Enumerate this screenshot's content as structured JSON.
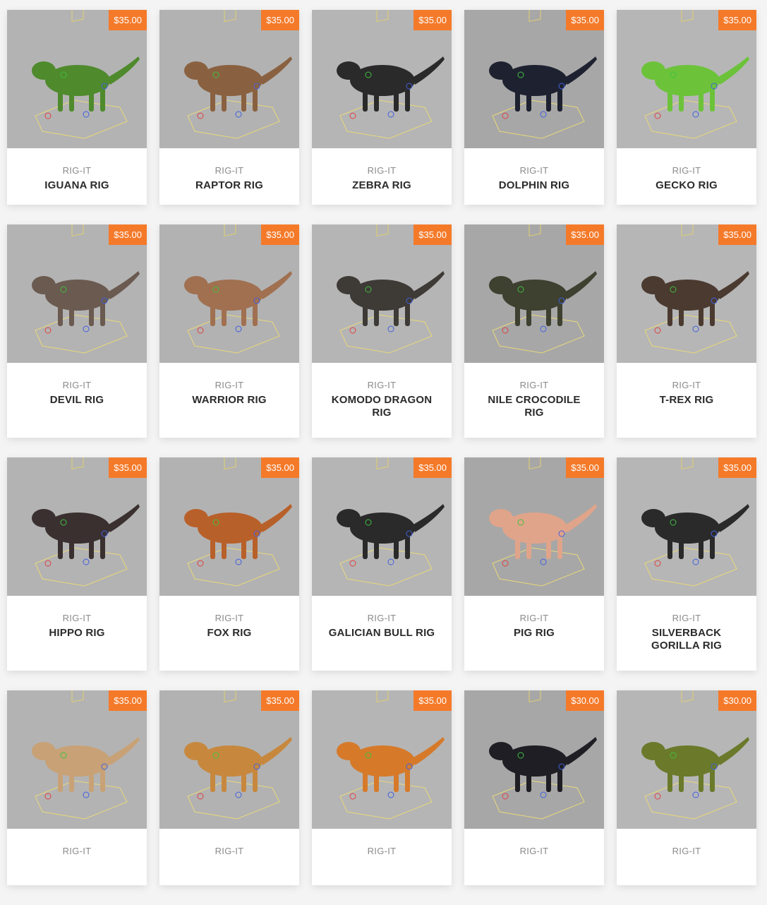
{
  "brand_label": "RIG-IT",
  "colors": {
    "price_badge": "#f47a2a",
    "thumb_bg": "#b4b4b4",
    "page_bg": "#f4f4f4"
  },
  "products": [
    {
      "name": "IGUANA RIG",
      "price": "$35.00",
      "icon": "iguana-icon",
      "color": "#4f8a2c"
    },
    {
      "name": "RAPTOR RIG",
      "price": "$35.00",
      "icon": "raptor-icon",
      "color": "#8a6140"
    },
    {
      "name": "ZEBRA RIG",
      "price": "$35.00",
      "icon": "zebra-icon",
      "color": "#2a2a2a"
    },
    {
      "name": "DOLPHIN RIG",
      "price": "$35.00",
      "icon": "dolphin-icon",
      "color": "#1e2230"
    },
    {
      "name": "GECKO RIG",
      "price": "$35.00",
      "icon": "gecko-icon",
      "color": "#6cc33a"
    },
    {
      "name": "DEVIL RIG",
      "price": "$35.00",
      "icon": "devil-icon",
      "color": "#6a5a50"
    },
    {
      "name": "WARRIOR RIG",
      "price": "$35.00",
      "icon": "warrior-icon",
      "color": "#a07050"
    },
    {
      "name": "KOMODO DRAGON RIG",
      "price": "$35.00",
      "icon": "komodo-dragon-icon",
      "color": "#3e3a36"
    },
    {
      "name": "NILE CROCODILE RIG",
      "price": "$35.00",
      "icon": "crocodile-icon",
      "color": "#3e4030"
    },
    {
      "name": "T-REX RIG",
      "price": "$35.00",
      "icon": "t-rex-icon",
      "color": "#4a3a30"
    },
    {
      "name": "HIPPO RIG",
      "price": "$35.00",
      "icon": "hippo-icon",
      "color": "#3a3030"
    },
    {
      "name": "FOX RIG",
      "price": "$35.00",
      "icon": "fox-icon",
      "color": "#b8602a"
    },
    {
      "name": "GALICIAN BULL RIG",
      "price": "$35.00",
      "icon": "bull-icon",
      "color": "#2a2a2a"
    },
    {
      "name": "PIG RIG",
      "price": "$35.00",
      "icon": "pig-icon",
      "color": "#e0a48a"
    },
    {
      "name": "SILVERBACK GORILLA RIG",
      "price": "$35.00",
      "icon": "gorilla-icon",
      "color": "#2a2a2a"
    },
    {
      "name": "",
      "price": "$35.00",
      "icon": "french-bulldog-icon",
      "color": "#c8a276"
    },
    {
      "name": "",
      "price": "$35.00",
      "icon": "mastiff-dog-icon",
      "color": "#c7883e"
    },
    {
      "name": "",
      "price": "$35.00",
      "icon": "tiger-icon",
      "color": "#d67a2a"
    },
    {
      "name": "",
      "price": "$30.00",
      "icon": "scorpion-icon",
      "color": "#1e1e24"
    },
    {
      "name": "",
      "price": "$30.00",
      "icon": "frog-icon",
      "color": "#6a7a2a"
    }
  ]
}
